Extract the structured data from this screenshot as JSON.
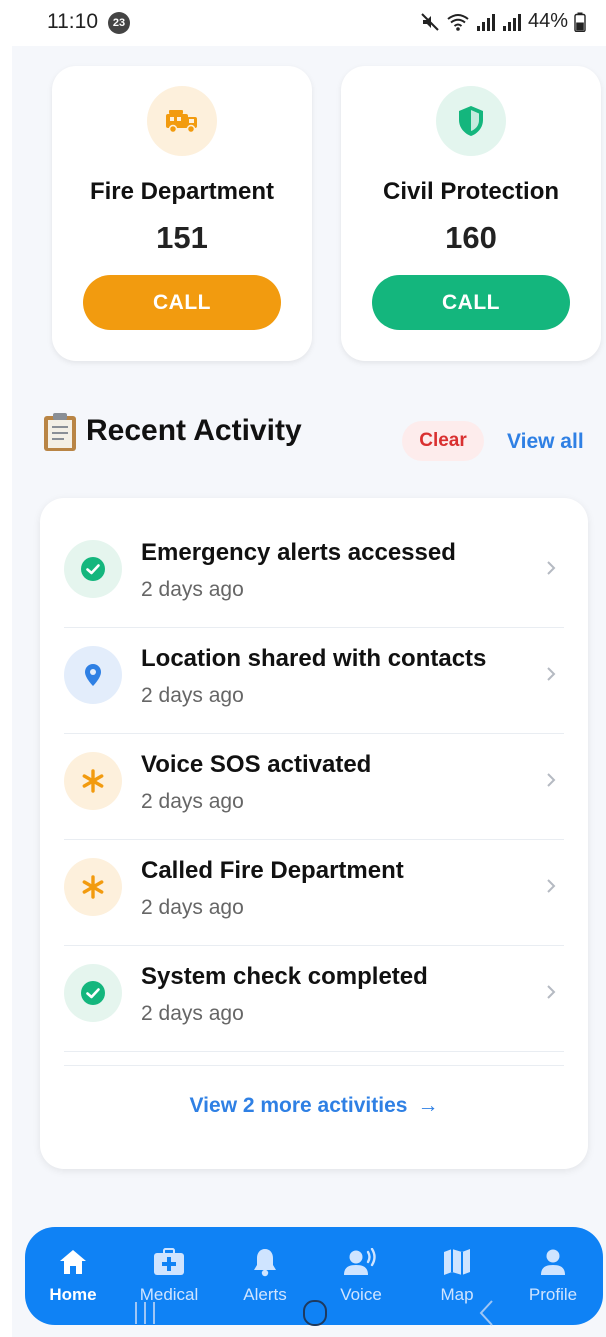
{
  "status_bar": {
    "time": "11:10",
    "notification_count": "23",
    "battery": "44%"
  },
  "services": [
    {
      "name": "Fire Department",
      "number": "151",
      "call_label": "CALL",
      "icon": "fire-truck-icon",
      "color": "#f29b0f"
    },
    {
      "name": "Civil Protection",
      "number": "160",
      "call_label": "CALL",
      "icon": "shield-icon",
      "color": "#14b67d"
    }
  ],
  "recent_activity": {
    "title": "Recent Activity",
    "clear_label": "Clear",
    "view_all_label": "View all",
    "items": [
      {
        "title": "Emergency alerts accessed",
        "time": "2 days ago",
        "icon": "check-circle-icon",
        "tone": "green"
      },
      {
        "title": "Location shared with contacts",
        "time": "2 days ago",
        "icon": "location-pin-icon",
        "tone": "blue"
      },
      {
        "title": "Voice SOS activated",
        "time": "2 days ago",
        "icon": "asterisk-icon",
        "tone": "orange"
      },
      {
        "title": "Called Fire Department",
        "time": "2 days ago",
        "icon": "asterisk-icon",
        "tone": "orange"
      },
      {
        "title": "System check completed",
        "time": "2 days ago",
        "icon": "check-circle-icon",
        "tone": "green"
      }
    ],
    "view_more_label": "View 2 more activities",
    "view_more_arrow": "→"
  },
  "bottom_nav": {
    "items": [
      {
        "label": "Home",
        "icon": "home-icon",
        "active": true
      },
      {
        "label": "Medical",
        "icon": "medical-kit-icon",
        "active": false
      },
      {
        "label": "Alerts",
        "icon": "bell-icon",
        "active": false
      },
      {
        "label": "Voice",
        "icon": "voice-icon",
        "active": false
      },
      {
        "label": "Map",
        "icon": "map-icon",
        "active": false
      },
      {
        "label": "Profile",
        "icon": "person-icon",
        "active": false
      }
    ]
  },
  "colors": {
    "primary": "#0f82f5",
    "fire": "#f29b0f",
    "civil": "#14b67d",
    "danger": "#d93030",
    "link": "#2f80e4"
  }
}
